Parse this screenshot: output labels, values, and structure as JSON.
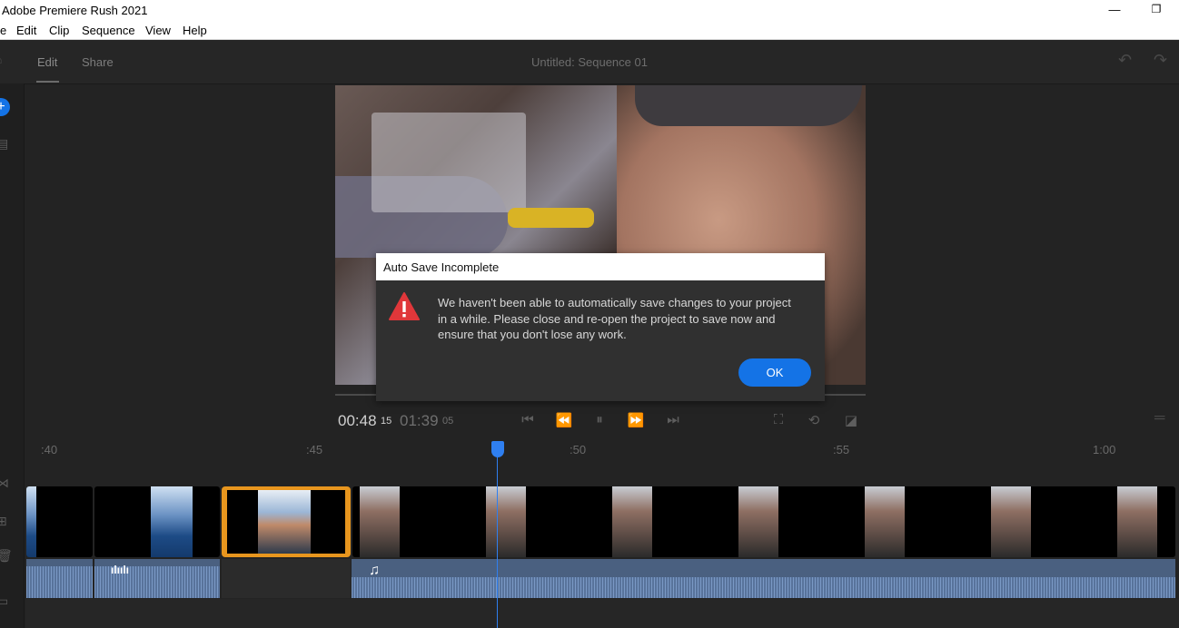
{
  "window": {
    "title": "Adobe Premiere Rush 2021",
    "minimize_glyph": "—",
    "restore_glyph": "❐"
  },
  "menu": [
    "e",
    "Edit",
    "Clip",
    "Sequence",
    "View",
    "Help"
  ],
  "header": {
    "tabs": [
      "Edit",
      "Share"
    ],
    "sequence_title": "Untitled: Sequence 01",
    "undo_glyph": "↶",
    "redo_glyph": "↷"
  },
  "transport": {
    "current_time": "00:48",
    "current_frames": "15",
    "total_time": "01:39",
    "total_frames": "05"
  },
  "timeline": {
    "ruler_ticks": [
      ":40",
      ":45",
      ":50",
      ":55",
      "1:00"
    ]
  },
  "dialog": {
    "title": "Auto Save Incomplete",
    "message": "We haven't been able to automatically save changes to your project in a while. Please close and re-open the project to save now and ensure that you don't lose any work.",
    "ok_label": "OK"
  },
  "icons": {
    "warning": "warning-triangle-icon",
    "music": "♫",
    "voiceover": "ılıılı"
  },
  "colors": {
    "accent_blue": "#1473e6",
    "playhead": "#2f7ff0",
    "selected_clip": "#e8961e",
    "warning_red": "#e0373a"
  }
}
